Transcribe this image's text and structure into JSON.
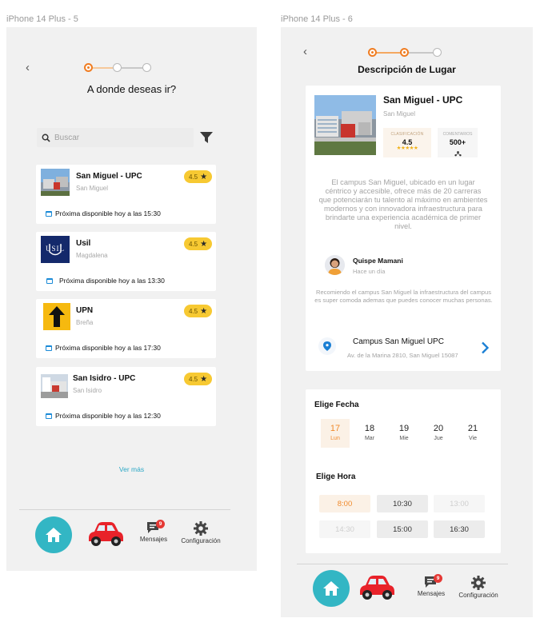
{
  "frames": [
    {
      "label": "iPhone 14 Plus - 5"
    },
    {
      "label": "iPhone 14 Plus - 6"
    }
  ],
  "screen1": {
    "title": "A donde deseas ir?",
    "search_placeholder": "Buscar",
    "places": [
      {
        "name": "San Miguel - UPC",
        "district": "San Miguel",
        "rating": "4.5",
        "availability": "Próxima disponible hoy a las 15:30"
      },
      {
        "name": "Usil",
        "district": "Magdalena",
        "rating": "4.5",
        "availability": "Próxima disponible hoy a las 13:30"
      },
      {
        "name": "UPN",
        "district": "Breña",
        "rating": "4.5",
        "availability": "Próxima disponible hoy a las 17:30"
      },
      {
        "name": "San Isidro - UPC",
        "district": "San Isidro",
        "rating": "4.5",
        "availability": "Próxima disponible hoy a las 12:30"
      }
    ],
    "see_more": "Ver más",
    "usil_logo_text": "USIL"
  },
  "screen2": {
    "title": "Descripción de Lugar",
    "place": {
      "name": "San Miguel - UPC",
      "district": "San Miguel",
      "classification_label": "CLASIFICACIÓN",
      "classification_value": "4.5",
      "comments_label": "COMENTARIOS",
      "comments_value": "500+",
      "description": "El campus San Miguel, ubicado en un lugar céntrico y accesible, ofrece más de 20 carreras que potenciarán tu talento al máximo en ambientes modernos y con innovadora infraestructura para brindarte una experiencia académica de primer nivel."
    },
    "review": {
      "author": "Quispe Mamani",
      "time": "Hace un día",
      "text": "Recomiendo el campus San Miguel la infraestructura del campus es super comoda ademas que puedes conocer muchas personas."
    },
    "location": {
      "name": "Campus San Miguel UPC",
      "address": "Av. de la Marina 2810, San Miguel 15087"
    },
    "date_section": "Elige Fecha",
    "dates": [
      {
        "day": "17",
        "weekday": "Lun",
        "selected": true
      },
      {
        "day": "18",
        "weekday": "Mar",
        "selected": false
      },
      {
        "day": "19",
        "weekday": "Mie",
        "selected": false
      },
      {
        "day": "20",
        "weekday": "Jue",
        "selected": false
      },
      {
        "day": "21",
        "weekday": "Vie",
        "selected": false
      }
    ],
    "hour_section": "Elige Hora",
    "hours": [
      {
        "time": "8:00",
        "state": "selected"
      },
      {
        "time": "10:30",
        "state": "available"
      },
      {
        "time": "13:00",
        "state": "disabled"
      },
      {
        "time": "14:30",
        "state": "disabled"
      },
      {
        "time": "15:00",
        "state": "available"
      },
      {
        "time": "16:30",
        "state": "available"
      }
    ]
  },
  "nav": {
    "messages_label": "Mensajes",
    "settings_label": "Configuración",
    "messages_badge": "9"
  },
  "colors": {
    "accent_orange": "#f07d22",
    "teal": "#33b6c4",
    "rating_yellow": "#f7c932",
    "link_blue": "#1a8ad7",
    "badge_red": "#e53935"
  }
}
